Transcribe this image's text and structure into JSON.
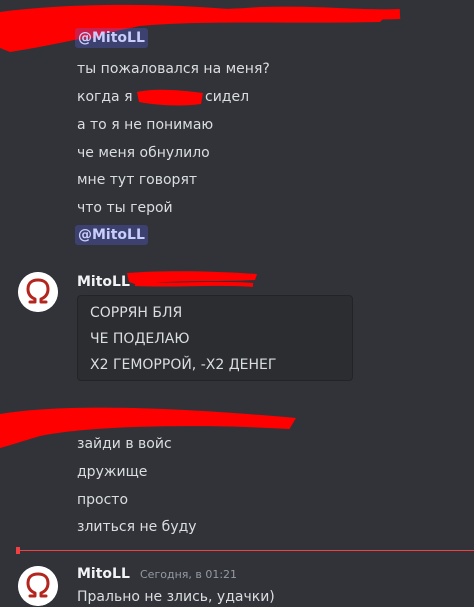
{
  "messages": {
    "group1": {
      "mention_top": "@MitoLL",
      "lines": [
        "ты пожаловался на меня?",
        "когда я",
        "сидел",
        "а то я не понимаю",
        "че меня обнулило",
        "мне тут говорят",
        "что ты герой"
      ],
      "mention_bottom": "@MitoLL"
    },
    "group2": {
      "username": "MitoLL",
      "code_lines": [
        "СОРРЯН БЛЯ",
        "ЧЕ ПОДЕЛАЮ",
        "Х2 ГЕМОРРОЙ, -Х2 ДЕНЕГ"
      ]
    },
    "group3": {
      "lines": [
        "зайди в войс",
        "дружище",
        "просто",
        "злиться не буду"
      ]
    },
    "group4": {
      "username": "MitoLL",
      "timestamp": "Сегодня, в 01:21",
      "text": "Прально не злись, удачки)"
    }
  },
  "colors": {
    "background": "#313338",
    "mention_bg": "#414675",
    "redaction": "#ff0000",
    "new_messages_divider": "#f23f42"
  },
  "icons": {
    "avatar": "omega-symbol-avatar"
  }
}
